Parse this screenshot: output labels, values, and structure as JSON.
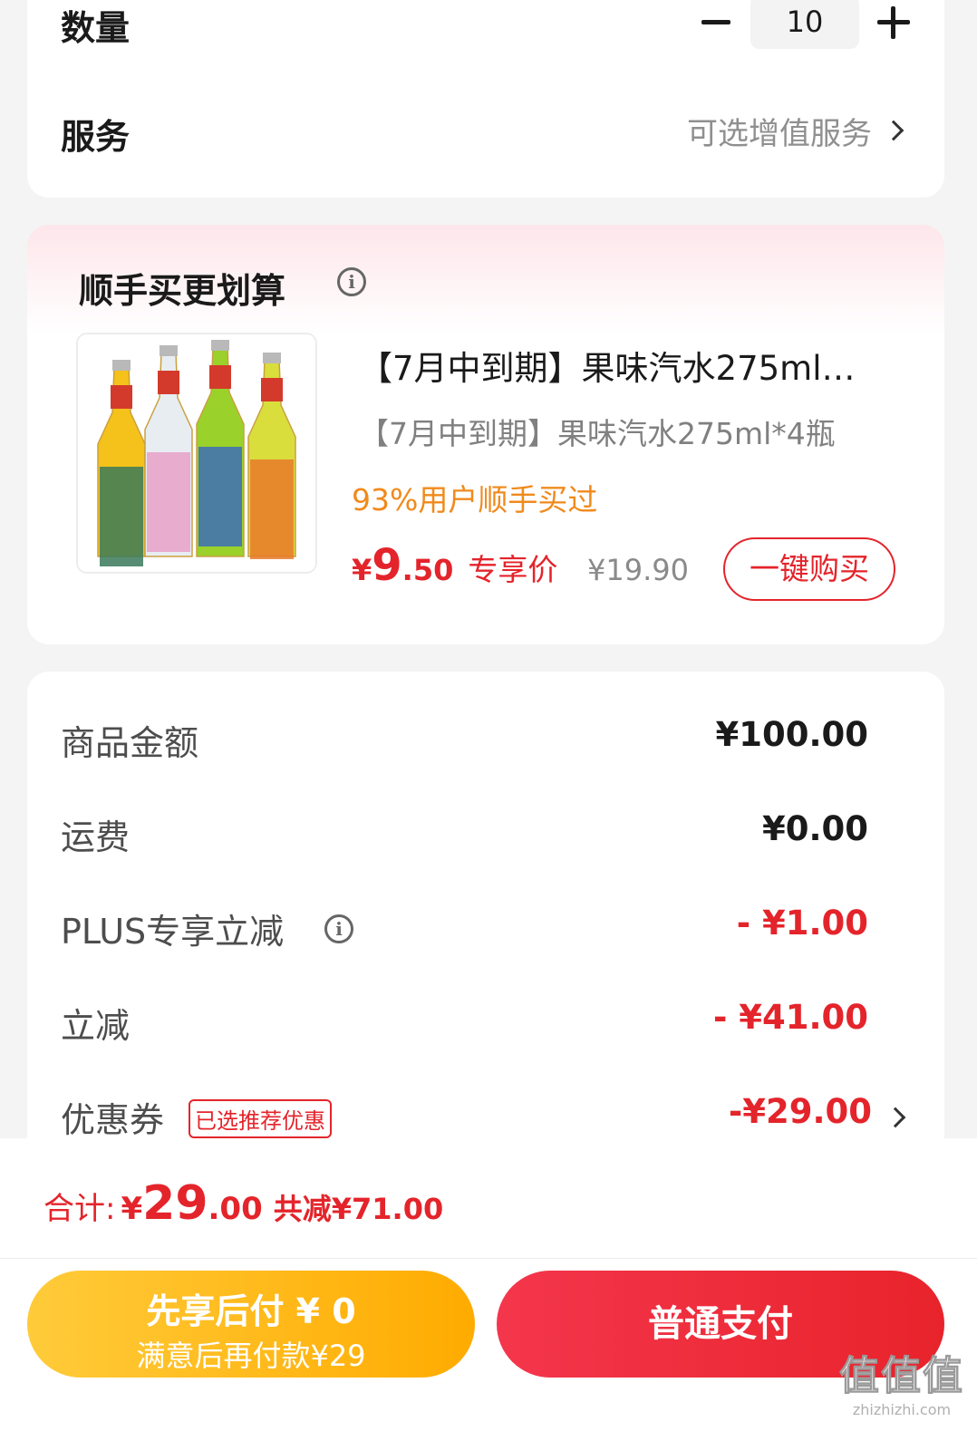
{
  "quantity": {
    "label": "数量",
    "value": "10"
  },
  "service": {
    "label": "服务",
    "value": "可选增值服务"
  },
  "bundle": {
    "title": "顺手买更划算",
    "product": {
      "title": "【7月中到期】果味汽水275ml…",
      "subtitle": "【7月中到期】果味汽水275ml*4瓶",
      "social_proof": "93%用户顺手买过",
      "price_symbol": "¥",
      "price_integer": "9",
      "price_decimal": ".50",
      "price_label": "专享价",
      "original_price": "¥19.90",
      "buy_label": "一键购买",
      "bottle_colors": [
        "#f4c21a",
        "#e8edf2",
        "#9ad12a",
        "#d9de3c"
      ]
    }
  },
  "summary": {
    "rows": [
      {
        "label": "商品金额",
        "value": "¥100.00"
      },
      {
        "label": "运费",
        "value": "¥0.00"
      },
      {
        "label": "PLUS专享立减",
        "value": "- ¥1.00"
      },
      {
        "label": "立减",
        "value": "- ¥41.00"
      },
      {
        "label": "优惠券",
        "badge": "已选推荐优惠",
        "value": "-¥29.00"
      }
    ]
  },
  "total": {
    "label": "合计:",
    "symbol": "¥",
    "integer": "29",
    "decimal": ".00",
    "savings": "共减¥71.00"
  },
  "buttons": {
    "pay_later_line1": "先享后付 ¥ 0",
    "pay_later_line2": "满意后再付款¥29",
    "pay_normal": "普通支付"
  },
  "watermark": {
    "main": "值值值",
    "url": "zhizhizhi.com"
  },
  "colors": {
    "accent_red": "#e4242b",
    "orange": "#f08a1c",
    "gold": "#ffb400"
  }
}
